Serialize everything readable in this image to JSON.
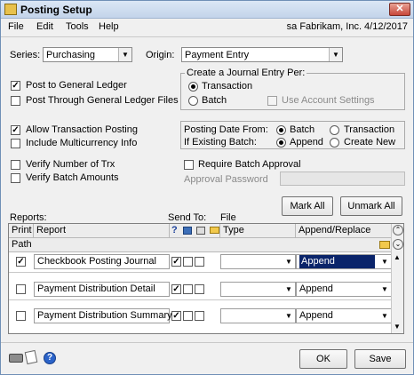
{
  "window": {
    "title": "Posting Setup",
    "close_label": "✕"
  },
  "menu": {
    "items": [
      "File",
      "Edit",
      "Tools",
      "Help"
    ],
    "status": "sa  Fabrikam, Inc.  4/12/2017"
  },
  "series": {
    "label": "Series:",
    "value": "Purchasing"
  },
  "origin": {
    "label": "Origin:",
    "value": "Payment Entry"
  },
  "options": {
    "post_to_gl": {
      "label": "Post to General Ledger",
      "checked": true
    },
    "post_through_gl": {
      "label": "Post Through General Ledger Files",
      "checked": false
    },
    "allow_transaction": {
      "label": "Allow Transaction Posting",
      "checked": true
    },
    "include_multicurrency": {
      "label": "Include Multicurrency Info",
      "checked": false
    },
    "verify_trx": {
      "label": "Verify Number of Trx",
      "checked": false
    },
    "verify_batch": {
      "label": "Verify Batch Amounts",
      "checked": false
    },
    "require_batch_approval": {
      "label": "Require Batch Approval",
      "checked": false
    },
    "approval_password": {
      "label": "Approval Password"
    }
  },
  "journal_entry": {
    "title": "Create a Journal Entry Per:",
    "transaction": "Transaction",
    "batch": "Batch",
    "use_account_settings": "Use Account Settings"
  },
  "posting_date": {
    "label": "Posting Date From:",
    "batch": "Batch",
    "transaction": "Transaction"
  },
  "existing_batch": {
    "label": "If Existing Batch:",
    "append": "Append",
    "create_new": "Create New"
  },
  "buttons": {
    "mark_all": "Mark All",
    "unmark_all": "Unmark All",
    "ok": "OK",
    "save": "Save"
  },
  "reports_section": {
    "reports_label": "Reports:",
    "send_to_label": "Send To:",
    "file_label": "File"
  },
  "grid": {
    "headers": {
      "print": "Print",
      "report": "Report",
      "help": "?",
      "type": "Type",
      "append_replace": "Append/Replace",
      "path": "Path"
    },
    "rows": [
      {
        "print": true,
        "report": "Checkbook Posting Journal",
        "send_screen": true,
        "append": "Append",
        "selected": true
      },
      {
        "print": false,
        "report": "Payment Distribution Detail",
        "send_screen": true,
        "append": "Append",
        "selected": false
      },
      {
        "print": false,
        "report": "Payment Distribution Summary",
        "send_screen": true,
        "append": "Append",
        "selected": false
      }
    ]
  },
  "colors": {
    "title_bar": "#c3d4ea",
    "selection": "#0a246a",
    "folder": "#f2c94c"
  }
}
